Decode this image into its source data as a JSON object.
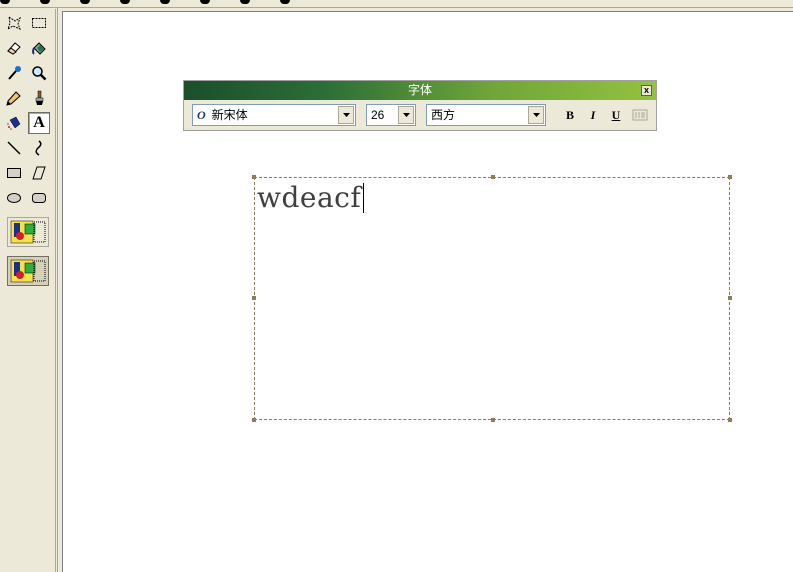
{
  "font_toolbar": {
    "title": "字体",
    "close_glyph": "x",
    "font_name": "新宋体",
    "font_glyph": "O",
    "font_size": "26",
    "script": "西方",
    "bold_label": "B",
    "italic_label": "I",
    "underline_label": "U",
    "vertical_label": "IIIII"
  },
  "text_box": {
    "content": "wdeacf"
  },
  "tools": [
    {
      "name": "free-form-select-icon",
      "active": false
    },
    {
      "name": "rect-select-icon",
      "active": false
    },
    {
      "name": "eraser-icon",
      "active": false
    },
    {
      "name": "fill-bucket-icon",
      "active": false
    },
    {
      "name": "color-picker-icon",
      "active": false
    },
    {
      "name": "magnifier-icon",
      "active": false
    },
    {
      "name": "pencil-icon",
      "active": false
    },
    {
      "name": "brush-icon",
      "active": false
    },
    {
      "name": "airbrush-icon",
      "active": false
    },
    {
      "name": "text-tool-icon",
      "active": true
    },
    {
      "name": "line-icon",
      "active": false
    },
    {
      "name": "curve-icon",
      "active": false
    },
    {
      "name": "rectangle-icon",
      "active": false
    },
    {
      "name": "polygon-icon",
      "active": false
    },
    {
      "name": "ellipse-icon",
      "active": false
    },
    {
      "name": "rounded-rect-icon",
      "active": false
    }
  ],
  "text_tool_label": "A",
  "colors": {
    "title_gradient_start": "#1a4f2a",
    "title_gradient_end": "#94c23f",
    "selection_border": "#8b7e5a"
  }
}
